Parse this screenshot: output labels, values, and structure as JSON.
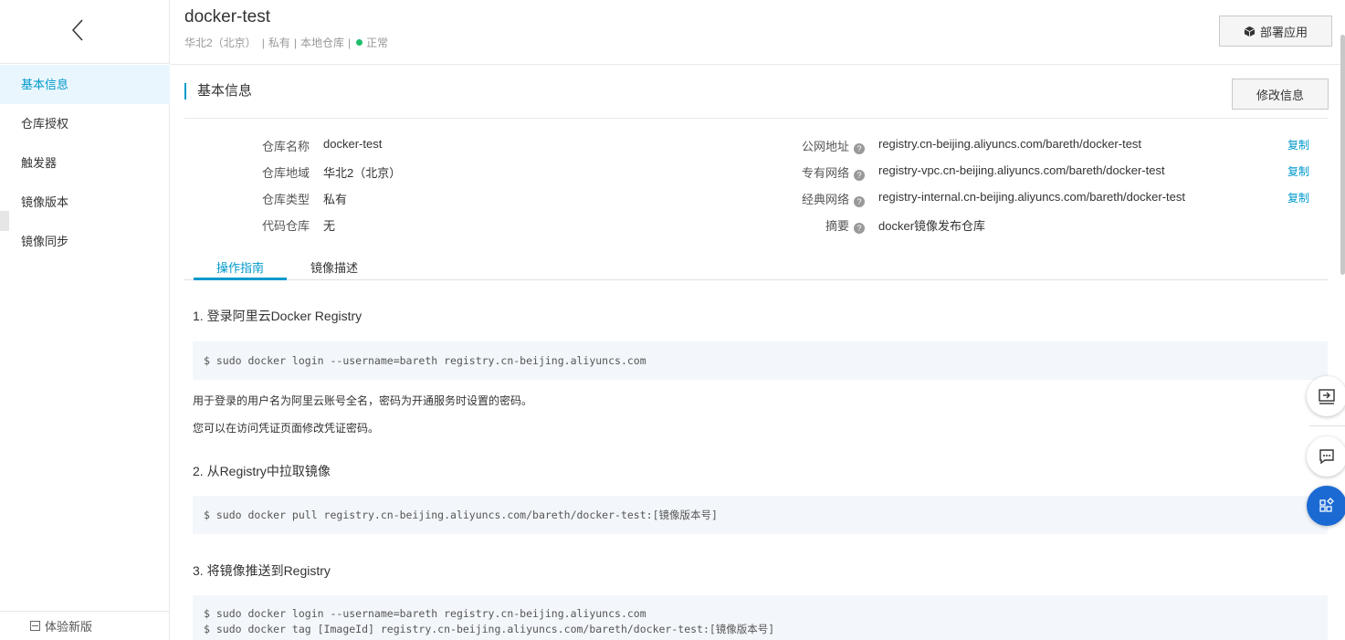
{
  "sidebar": {
    "items": [
      {
        "label": "基本信息",
        "active": true
      },
      {
        "label": "仓库授权"
      },
      {
        "label": "触发器"
      },
      {
        "label": "镜像版本"
      },
      {
        "label": "镜像同步"
      }
    ],
    "footer_label": "体验新版"
  },
  "header": {
    "title": "docker-test",
    "region": "华北2（北京）",
    "sep1": "|",
    "visibility": "私有",
    "sep2": "|",
    "repo_kind": "本地仓库",
    "sep3": "|",
    "status": "正常",
    "status_color": "#1ebe6b",
    "deploy_label": "部署应用"
  },
  "section": {
    "title": "基本信息",
    "edit_label": "修改信息"
  },
  "info_left": [
    {
      "label": "仓库名称",
      "value": "docker-test"
    },
    {
      "label": "仓库地域",
      "value": "华北2（北京）"
    },
    {
      "label": "仓库类型",
      "value": "私有"
    },
    {
      "label": "代码仓库",
      "value": "无"
    }
  ],
  "info_right": [
    {
      "label": "公网地址",
      "value": "registry.cn-beijing.aliyuncs.com/bareth/docker-test",
      "copy": "复制"
    },
    {
      "label": "专有网络",
      "value": "registry-vpc.cn-beijing.aliyuncs.com/bareth/docker-test",
      "copy": "复制"
    },
    {
      "label": "经典网络",
      "value": "registry-internal.cn-beijing.aliyuncs.com/bareth/docker-test",
      "copy": "复制"
    },
    {
      "label": "摘要",
      "value": "docker镜像发布仓库"
    }
  ],
  "help_glyph": "?",
  "tabs": [
    {
      "label": "操作指南",
      "active": true
    },
    {
      "label": "镜像描述"
    }
  ],
  "guide": {
    "step1_title": "1. 登录阿里云Docker Registry",
    "step1_code": "$ sudo docker login --username=bareth registry.cn-beijing.aliyuncs.com",
    "note1": "用于登录的用户名为阿里云账号全名，密码为开通服务时设置的密码。",
    "note2": "您可以在访问凭证页面修改凭证密码。",
    "step2_title": "2. 从Registry中拉取镜像",
    "step2_code": "$ sudo docker pull registry.cn-beijing.aliyuncs.com/bareth/docker-test:[镜像版本号]",
    "step3_title": "3. 将镜像推送到Registry",
    "step3_code1": "$ sudo docker login --username=bareth registry.cn-beijing.aliyuncs.com",
    "step3_code2": "$ sudo docker tag [ImageId] registry.cn-beijing.aliyuncs.com/bareth/docker-test:[镜像版本号]"
  },
  "colors": {
    "accent": "#0099cc",
    "float_blue": "#1b6ad3"
  },
  "floating": [
    "export-icon",
    "chat-icon",
    "apps-icon"
  ]
}
